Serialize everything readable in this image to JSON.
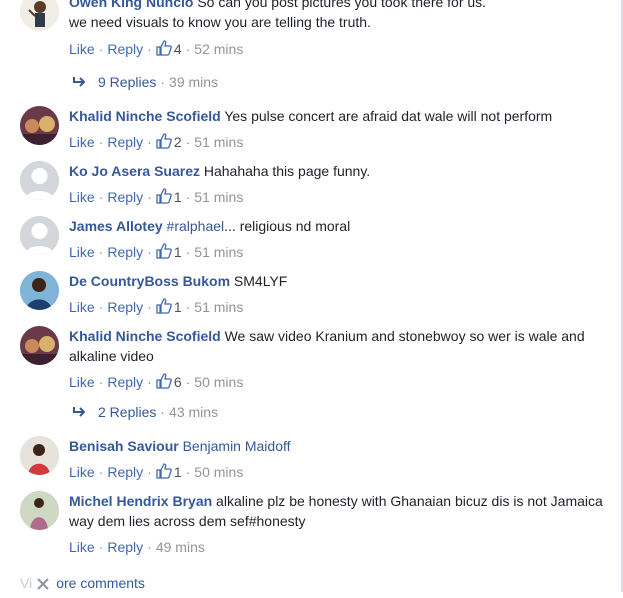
{
  "actions": {
    "like": "Like",
    "reply": "Reply",
    "dot": "·"
  },
  "comments": [
    {
      "author": "Owen King Nuncio",
      "text": "So can you post pictures you took there for us.\nwe need visuals to know you are telling the truth.",
      "likes": "4",
      "time": "52 mins",
      "avatar": "person-photo",
      "replies": {
        "label": "9 Replies",
        "time": "39 mins"
      }
    },
    {
      "author": "Khalid Ninche Scofield",
      "text": "Yes pulse concert are afraid dat wale will not perform",
      "likes": "2",
      "time": "51 mins",
      "avatar": "crowd-photo"
    },
    {
      "author": "Ko Jo Asera Suarez",
      "text": "Hahahaha this page funny.",
      "likes": "1",
      "time": "51 mins",
      "avatar": "default-silhouette"
    },
    {
      "author": "James Allotey",
      "mention": "#ralphael",
      "text": "... religious nd moral",
      "likes": "1",
      "time": "51 mins",
      "avatar": "default-silhouette"
    },
    {
      "author": "De CountryBoss Bukom",
      "text": "SM4LYF",
      "likes": "1",
      "time": "51 mins",
      "avatar": "person-photo-blue"
    },
    {
      "author": "Khalid Ninche Scofield",
      "text": "We saw video Kranium and stonebwoy so wer is wale and alkaline video",
      "likes": "6",
      "time": "50 mins",
      "avatar": "crowd-photo",
      "replies": {
        "label": "2 Replies",
        "time": "43 mins"
      }
    },
    {
      "author": "Benisah Saviour",
      "mention": "Benjamin Maidoff",
      "text": "",
      "likes": "1",
      "time": "50 mins",
      "avatar": "person-photo-red"
    },
    {
      "author": "Michel Hendrix Bryan",
      "text": "alkaline plz be honesty with Ghanaian bicuz dis is not Jamaica way dem lies across dem sef#honesty",
      "likes": "",
      "time": "49 mins",
      "avatar": "person-photo-outdoor"
    }
  ],
  "more_comments": {
    "visible": "ore comments",
    "hidden_prefix": "Vi",
    "close_icon": "close-icon"
  },
  "colors": {
    "link": "#365899",
    "action": "#4267b2",
    "meta": "#90949c"
  }
}
